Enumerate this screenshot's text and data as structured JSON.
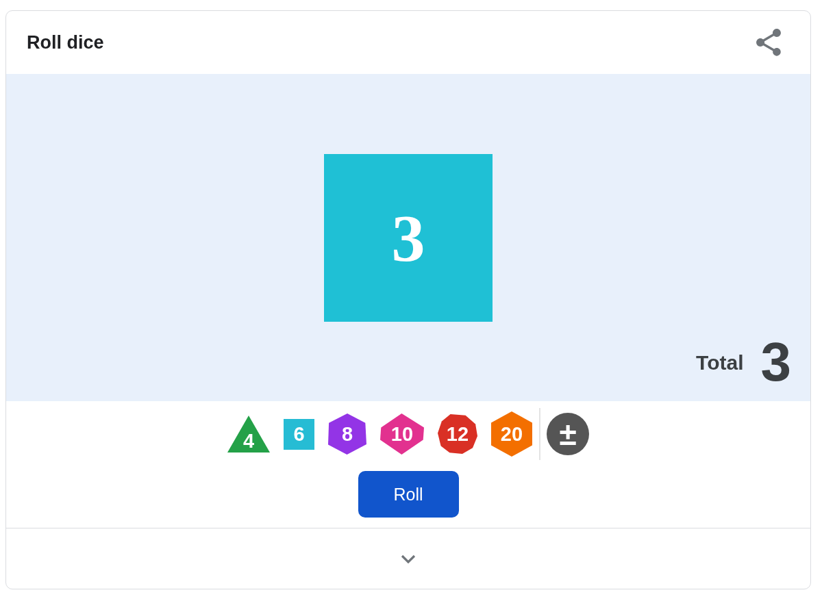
{
  "card": {
    "title": "Roll dice"
  },
  "result": {
    "dice": [
      {
        "kind": "d6",
        "color": "#1fc0d5",
        "value": "3"
      }
    ],
    "total": {
      "label": "Total",
      "value": "3"
    }
  },
  "dice": [
    {
      "kind": "d4",
      "label": "4",
      "color": "#24a148"
    },
    {
      "kind": "d6",
      "label": "6",
      "color": "#26bcd4"
    },
    {
      "kind": "d8",
      "label": "8",
      "color": "#9334e6"
    },
    {
      "kind": "d10",
      "label": "10",
      "color": "#e2318f"
    },
    {
      "kind": "d12",
      "label": "12",
      "color": "#d93025"
    },
    {
      "kind": "d20",
      "label": "20",
      "color": "#f36f00"
    }
  ],
  "modifier": {
    "label": "±"
  },
  "roll_button": {
    "label": "Roll"
  }
}
